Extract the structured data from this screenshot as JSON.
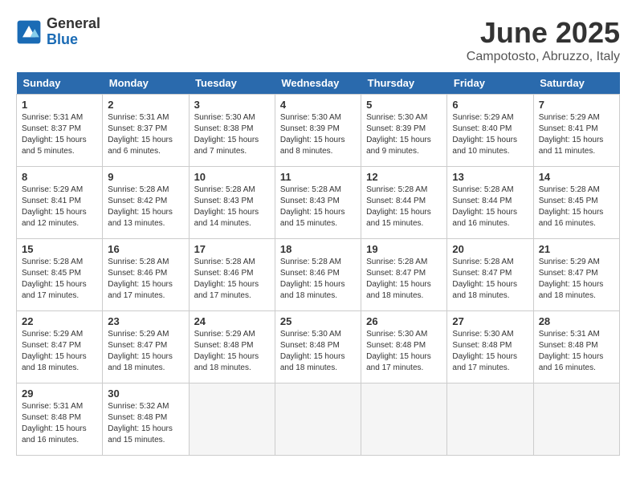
{
  "logo": {
    "general": "General",
    "blue": "Blue"
  },
  "title": "June 2025",
  "location": "Campotosto, Abruzzo, Italy",
  "headers": [
    "Sunday",
    "Monday",
    "Tuesday",
    "Wednesday",
    "Thursday",
    "Friday",
    "Saturday"
  ],
  "weeks": [
    [
      {
        "day": "1",
        "sunrise": "5:31 AM",
        "sunset": "8:37 PM",
        "daylight": "15 hours and 5 minutes."
      },
      {
        "day": "2",
        "sunrise": "5:31 AM",
        "sunset": "8:37 PM",
        "daylight": "15 hours and 6 minutes."
      },
      {
        "day": "3",
        "sunrise": "5:30 AM",
        "sunset": "8:38 PM",
        "daylight": "15 hours and 7 minutes."
      },
      {
        "day": "4",
        "sunrise": "5:30 AM",
        "sunset": "8:39 PM",
        "daylight": "15 hours and 8 minutes."
      },
      {
        "day": "5",
        "sunrise": "5:30 AM",
        "sunset": "8:39 PM",
        "daylight": "15 hours and 9 minutes."
      },
      {
        "day": "6",
        "sunrise": "5:29 AM",
        "sunset": "8:40 PM",
        "daylight": "15 hours and 10 minutes."
      },
      {
        "day": "7",
        "sunrise": "5:29 AM",
        "sunset": "8:41 PM",
        "daylight": "15 hours and 11 minutes."
      }
    ],
    [
      {
        "day": "8",
        "sunrise": "5:29 AM",
        "sunset": "8:41 PM",
        "daylight": "15 hours and 12 minutes."
      },
      {
        "day": "9",
        "sunrise": "5:28 AM",
        "sunset": "8:42 PM",
        "daylight": "15 hours and 13 minutes."
      },
      {
        "day": "10",
        "sunrise": "5:28 AM",
        "sunset": "8:43 PM",
        "daylight": "15 hours and 14 minutes."
      },
      {
        "day": "11",
        "sunrise": "5:28 AM",
        "sunset": "8:43 PM",
        "daylight": "15 hours and 15 minutes."
      },
      {
        "day": "12",
        "sunrise": "5:28 AM",
        "sunset": "8:44 PM",
        "daylight": "15 hours and 15 minutes."
      },
      {
        "day": "13",
        "sunrise": "5:28 AM",
        "sunset": "8:44 PM",
        "daylight": "15 hours and 16 minutes."
      },
      {
        "day": "14",
        "sunrise": "5:28 AM",
        "sunset": "8:45 PM",
        "daylight": "15 hours and 16 minutes."
      }
    ],
    [
      {
        "day": "15",
        "sunrise": "5:28 AM",
        "sunset": "8:45 PM",
        "daylight": "15 hours and 17 minutes."
      },
      {
        "day": "16",
        "sunrise": "5:28 AM",
        "sunset": "8:46 PM",
        "daylight": "15 hours and 17 minutes."
      },
      {
        "day": "17",
        "sunrise": "5:28 AM",
        "sunset": "8:46 PM",
        "daylight": "15 hours and 17 minutes."
      },
      {
        "day": "18",
        "sunrise": "5:28 AM",
        "sunset": "8:46 PM",
        "daylight": "15 hours and 18 minutes."
      },
      {
        "day": "19",
        "sunrise": "5:28 AM",
        "sunset": "8:47 PM",
        "daylight": "15 hours and 18 minutes."
      },
      {
        "day": "20",
        "sunrise": "5:28 AM",
        "sunset": "8:47 PM",
        "daylight": "15 hours and 18 minutes."
      },
      {
        "day": "21",
        "sunrise": "5:29 AM",
        "sunset": "8:47 PM",
        "daylight": "15 hours and 18 minutes."
      }
    ],
    [
      {
        "day": "22",
        "sunrise": "5:29 AM",
        "sunset": "8:47 PM",
        "daylight": "15 hours and 18 minutes."
      },
      {
        "day": "23",
        "sunrise": "5:29 AM",
        "sunset": "8:47 PM",
        "daylight": "15 hours and 18 minutes."
      },
      {
        "day": "24",
        "sunrise": "5:29 AM",
        "sunset": "8:48 PM",
        "daylight": "15 hours and 18 minutes."
      },
      {
        "day": "25",
        "sunrise": "5:30 AM",
        "sunset": "8:48 PM",
        "daylight": "15 hours and 18 minutes."
      },
      {
        "day": "26",
        "sunrise": "5:30 AM",
        "sunset": "8:48 PM",
        "daylight": "15 hours and 17 minutes."
      },
      {
        "day": "27",
        "sunrise": "5:30 AM",
        "sunset": "8:48 PM",
        "daylight": "15 hours and 17 minutes."
      },
      {
        "day": "28",
        "sunrise": "5:31 AM",
        "sunset": "8:48 PM",
        "daylight": "15 hours and 16 minutes."
      }
    ],
    [
      {
        "day": "29",
        "sunrise": "5:31 AM",
        "sunset": "8:48 PM",
        "daylight": "15 hours and 16 minutes."
      },
      {
        "day": "30",
        "sunrise": "5:32 AM",
        "sunset": "8:48 PM",
        "daylight": "15 hours and 15 minutes."
      },
      null,
      null,
      null,
      null,
      null
    ]
  ],
  "labels": {
    "sunrise": "Sunrise:",
    "sunset": "Sunset:",
    "daylight": "Daylight:"
  }
}
